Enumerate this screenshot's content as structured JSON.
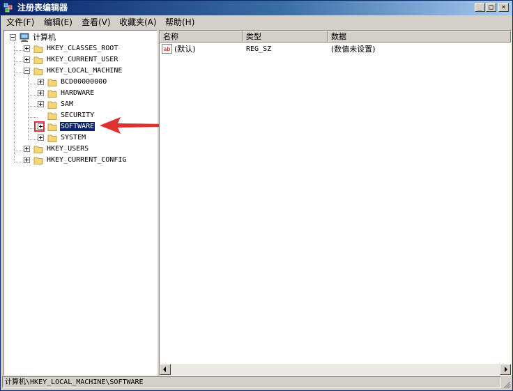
{
  "window": {
    "title": "注册表编辑器",
    "controls": {
      "minimize": "_",
      "maximize": "□",
      "close": "×"
    }
  },
  "menu": [
    {
      "label": "文件(F)"
    },
    {
      "label": "编辑(E)"
    },
    {
      "label": "查看(V)"
    },
    {
      "label": "收藏夹(A)"
    },
    {
      "label": "帮助(H)"
    }
  ],
  "tree": {
    "root": {
      "label": "计算机",
      "icon": "computer-icon",
      "expanded": true
    },
    "items": [
      {
        "label": "HKEY_CLASSES_ROOT",
        "level": 1,
        "toggle": "plus"
      },
      {
        "label": "HKEY_CURRENT_USER",
        "level": 1,
        "toggle": "plus"
      },
      {
        "label": "HKEY_LOCAL_MACHINE",
        "level": 1,
        "toggle": "minus"
      },
      {
        "label": "BCD00000000",
        "level": 2,
        "toggle": "plus"
      },
      {
        "label": "HARDWARE",
        "level": 2,
        "toggle": "plus"
      },
      {
        "label": "SAM",
        "level": 2,
        "toggle": "plus"
      },
      {
        "label": "SECURITY",
        "level": 2,
        "toggle": "none"
      },
      {
        "label": "SOFTWARE",
        "level": 2,
        "toggle": "plus",
        "selected": true,
        "highlighted": true
      },
      {
        "label": "SYSTEM",
        "level": 2,
        "toggle": "plus"
      },
      {
        "label": "HKEY_USERS",
        "level": 1,
        "toggle": "plus"
      },
      {
        "label": "HKEY_CURRENT_CONFIG",
        "level": 1,
        "toggle": "plus"
      }
    ]
  },
  "list": {
    "columns": [
      {
        "label": "名称"
      },
      {
        "label": "类型"
      },
      {
        "label": "数据"
      }
    ],
    "rows": [
      {
        "icon": "ab-string-icon",
        "name": "(默认)",
        "type": "REG_SZ",
        "data": "(数值未设置)"
      }
    ]
  },
  "statusbar": {
    "path": "计算机\\HKEY_LOCAL_MACHINE\\SOFTWARE"
  },
  "annotation": {
    "highlight_color": "#e03131",
    "arrow_color": "#e03131"
  },
  "colors": {
    "titlebar_start": "#0a246a",
    "titlebar_end": "#a6caf0",
    "selection": "#0a246a",
    "chrome": "#d4d0c8"
  }
}
